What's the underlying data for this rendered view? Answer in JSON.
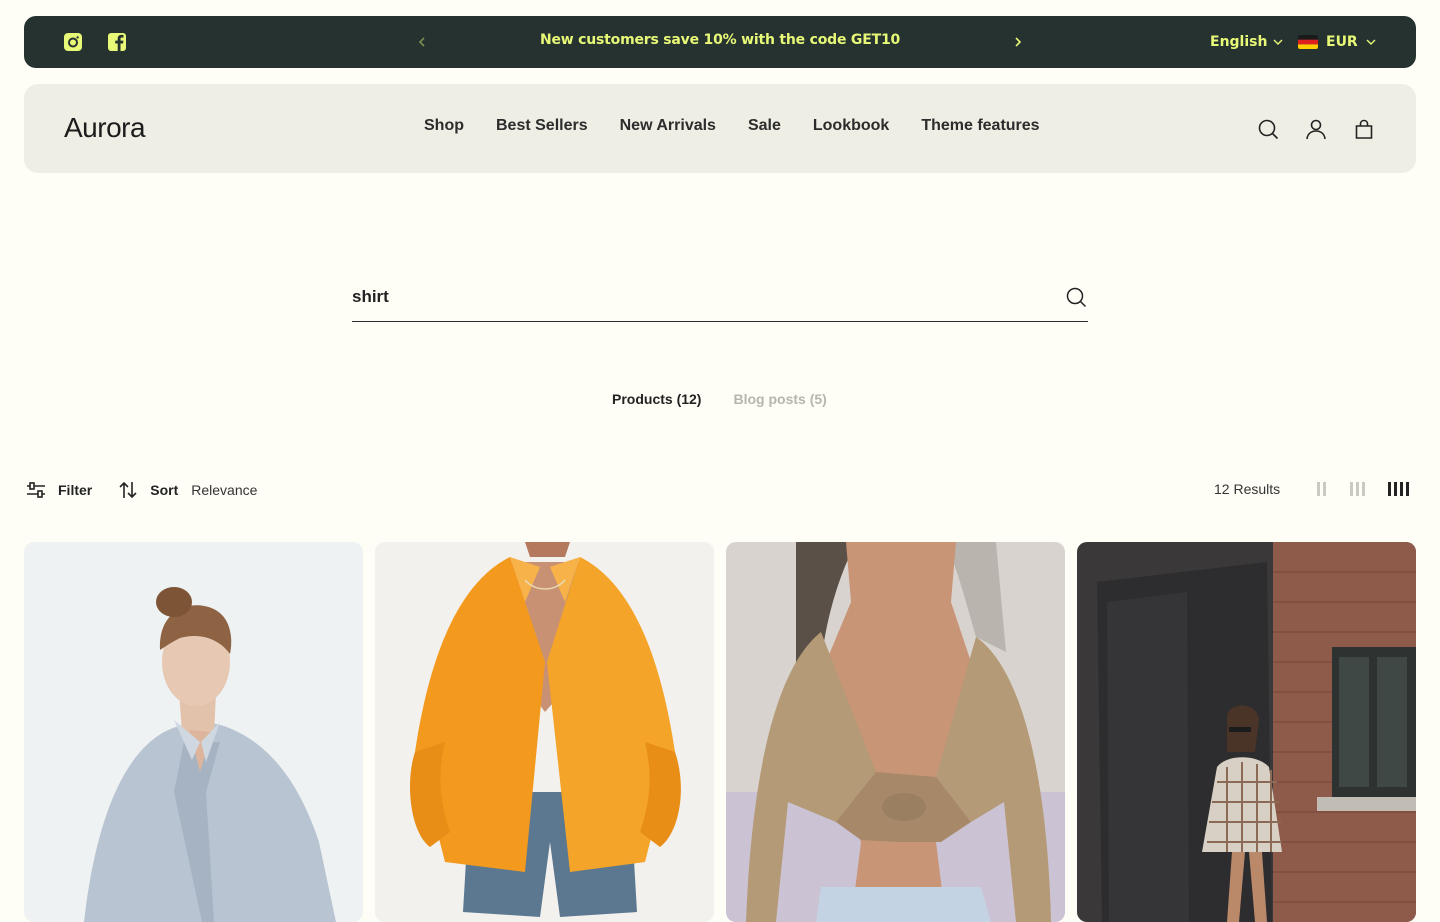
{
  "announcement": {
    "text": "New customers save 10% with the code GET10",
    "language": "English",
    "currency": "EUR"
  },
  "header": {
    "logo": "Aurora",
    "nav": [
      "Shop",
      "Best Sellers",
      "New Arrivals",
      "Sale",
      "Lookbook",
      "Theme features"
    ]
  },
  "search": {
    "query": "shirt"
  },
  "tabs": {
    "products": "Products (12)",
    "blog": "Blog posts (5)"
  },
  "toolbar": {
    "filter_label": "Filter",
    "sort_label": "Sort",
    "sort_value": "Relevance",
    "results": "12 Results"
  },
  "colors": {
    "background": "#fefdf6",
    "announcement_bg": "#253230",
    "announcement_text": "#e8f877",
    "header_bg": "#efeee4"
  },
  "icons": [
    "instagram-icon",
    "facebook-icon",
    "chevron-left-icon",
    "chevron-right-icon",
    "chevron-down-icon",
    "germany-flag-icon",
    "search-icon",
    "account-icon",
    "cart-icon",
    "filter-icon",
    "sort-icon",
    "grid-2-icon",
    "grid-3-icon",
    "grid-4-icon"
  ]
}
